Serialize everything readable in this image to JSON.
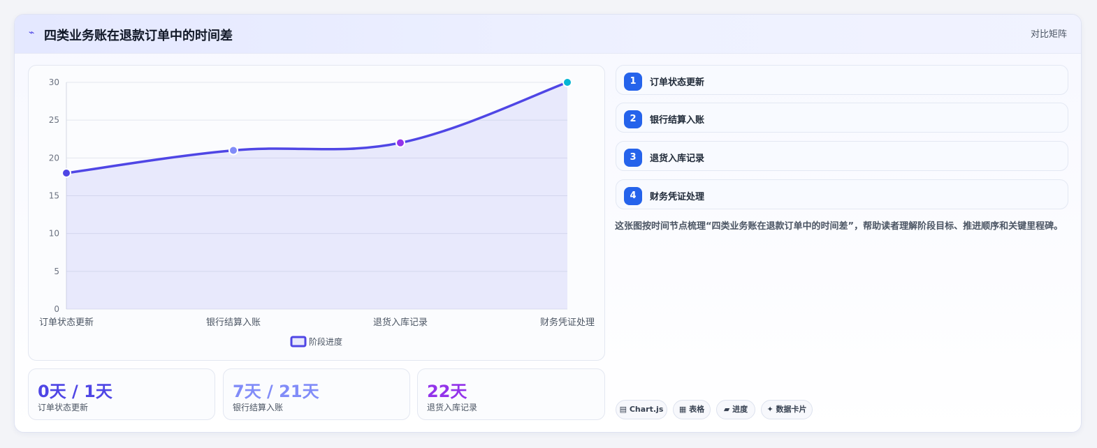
{
  "header": {
    "title": "四类业务账在退款订单中的时间差",
    "badge": "对比矩阵",
    "icon": "lightning-icon"
  },
  "chart_data": {
    "type": "line",
    "categories": [
      "订单状态更新",
      "银行结算入账",
      "退货入库记录",
      "财务凭证处理"
    ],
    "series": [
      {
        "name": "阶段进度",
        "values": [
          18,
          21,
          22,
          30
        ]
      }
    ],
    "point_colors": [
      "#4f46e5",
      "#818cf8",
      "#9333ea",
      "#06b6d4"
    ],
    "line_color": "#4f46e5",
    "ylim": [
      0,
      30
    ],
    "yticks": [
      0,
      5,
      10,
      15,
      20,
      25,
      30
    ],
    "grid": true,
    "legend": "bottom"
  },
  "stats": [
    {
      "value": "0天 / 1天",
      "label": "订单状态更新",
      "color": "#4f46e5"
    },
    {
      "value": "7天 / 21天",
      "label": "银行结算入账",
      "color": "#818cf8"
    },
    {
      "value": "22天",
      "label": "退货入库记录",
      "color": "#9333ea"
    }
  ],
  "steps": [
    {
      "num": "1",
      "label": "订单状态更新"
    },
    {
      "num": "2",
      "label": "银行结算入账"
    },
    {
      "num": "3",
      "label": "退货入库记录"
    },
    {
      "num": "4",
      "label": "财务凭证处理"
    }
  ],
  "description": "这张图按时间节点梳理“四类业务账在退款订单中的时间差”，帮助读者理解阶段目标、推进顺序和关键里程碑。",
  "tags": [
    {
      "icon": "▤",
      "label": "Chart.js"
    },
    {
      "icon": "▦",
      "label": "表格"
    },
    {
      "icon": "▰",
      "label": "进度"
    },
    {
      "icon": "✦",
      "label": "数据卡片"
    }
  ]
}
